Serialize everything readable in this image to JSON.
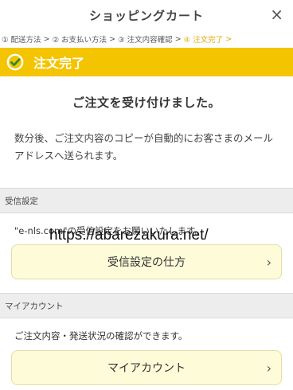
{
  "header": {
    "title": "ショッピングカート",
    "close_icon": "×"
  },
  "steps": [
    {
      "label": "① 配送方法",
      "active": false
    },
    {
      "label": "② お支払い方法",
      "active": false
    },
    {
      "label": "③ 注文内容確認",
      "active": false
    },
    {
      "label": "④ 注文完了",
      "active": true
    }
  ],
  "step_separator": ">",
  "banner": {
    "label": "注文完了",
    "color": "#f4c400"
  },
  "main": {
    "headline": "ご注文を受け付けました。",
    "description": "数分後、ご注文内容のコピーが自動的にお客さまのメールアドレスへ送られます。"
  },
  "reception": {
    "section_title": "受信設定",
    "note": "\"e-nls.com\"の受信設定をお願いいたします。",
    "button_label": "受信設定の仕方"
  },
  "watermark": "https://abarezakura.net/",
  "account": {
    "section_title": "マイアカウント",
    "note": "ご注文内容・発送状況の確認ができます。",
    "button_label": "マイアカウント"
  },
  "chevron": "›"
}
